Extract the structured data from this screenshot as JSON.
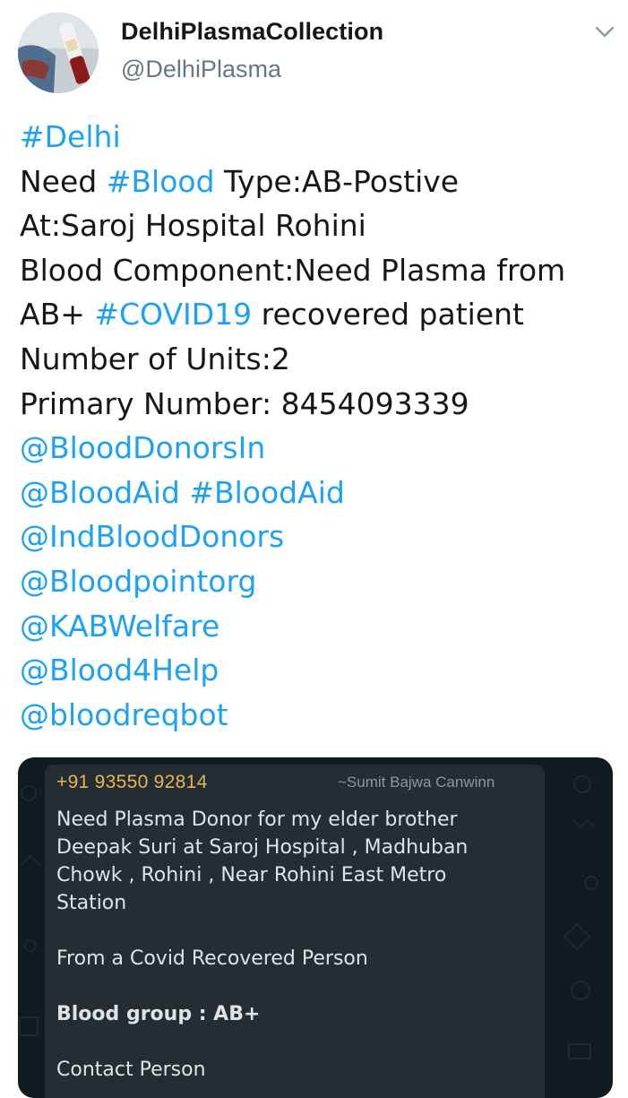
{
  "tweet": {
    "display_name": "DelhiPlasmaCollection",
    "handle": "@DelhiPlasma",
    "menu_icon": "chevron-down-icon",
    "lines": {
      "l1_tag": "#Delhi",
      "l2_a": "Need ",
      "l2_tag": "#Blood",
      "l2_b": " Type:AB-Postive",
      "l3": "At:Saroj Hospital  Rohini",
      "l4": "Blood Component:Need Plasma from",
      "l5_a": "AB+ ",
      "l5_tag": "#COVID19",
      "l5_b": " recovered patient",
      "l6": "Number of Units:2",
      "l7": "Primary Number: 8454093339",
      "m1": "@BloodDonorsIn",
      "m2_a": "@BloodAid",
      "m2_sp": " ",
      "m2_b": "#BloodAid",
      "m3": "@IndBloodDonors",
      "m4": "@Bloodpointorg",
      "m5": "@KABWelfare",
      "m6": "@Blood4Help",
      "m7": "@bloodreqbot"
    },
    "colors": {
      "link": "#1da1f2",
      "text": "#14171a",
      "secondary": "#657786"
    }
  },
  "media": {
    "phone": "+91 93550 92814",
    "sender": "~Sumit Bajwa Canwinn",
    "message": {
      "p1": "Need Plasma Donor for my elder brother",
      "p2": "Deepak Suri at Saroj Hospital , Madhuban",
      "p3": "Chowk , Rohini , Near Rohini East Metro",
      "p4": "Station",
      "p5": "From a Covid Recovered Person",
      "p6": "Blood group : AB+",
      "p7": "Contact Person"
    },
    "colors": {
      "phone": "#e9b54b",
      "bubble": "#232d33",
      "background": "#0f1b20"
    }
  }
}
